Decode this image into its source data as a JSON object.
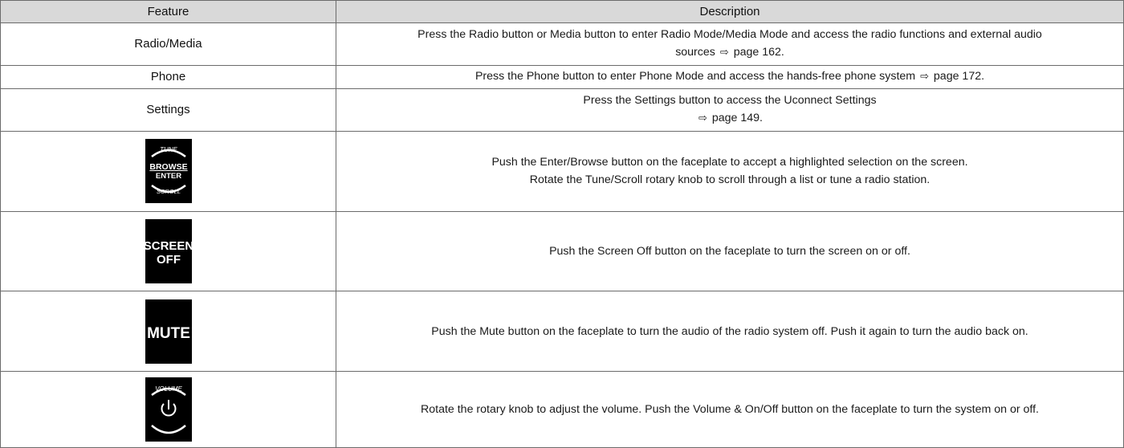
{
  "header": {
    "feature": "Feature",
    "description": "Description"
  },
  "rows": [
    {
      "feature": "Radio/Media",
      "desc_main": "Press the Radio button or Media button to enter Radio Mode/Media Mode and access the radio functions and external audio sources",
      "page_ref": "page 162."
    },
    {
      "feature": "Phone",
      "desc_main": "Press the Phone button to enter Phone Mode and access the hands-free phone system",
      "page_ref": "page 172."
    },
    {
      "feature": "Settings",
      "desc_main": "Press the Settings button to access the Uconnect Settings",
      "page_ref": "page 149."
    },
    {
      "icon": "browse-enter-knob-icon",
      "icon_text": {
        "top": "TUNE",
        "mid1": "BROWSE",
        "mid2": "ENTER",
        "bottom": "SCROLL"
      },
      "desc_line1": "Push the Enter/Browse button on the faceplate to accept a highlighted selection on the screen.",
      "desc_line2": "Rotate the Tune/Scroll rotary knob to scroll through a list or tune a radio station."
    },
    {
      "icon": "screen-off-icon",
      "icon_text": {
        "line1": "SCREEN",
        "line2": "OFF"
      },
      "desc_main": "Push the Screen Off button on the faceplate to turn the screen on or off."
    },
    {
      "icon": "mute-icon",
      "icon_text": {
        "line1": "MUTE"
      },
      "desc_main": "Push the Mute button on the faceplate to turn the audio of the radio system off. Push it again to turn the audio back on."
    },
    {
      "icon": "volume-power-knob-icon",
      "icon_text": {
        "top": "VOLUME"
      },
      "desc_main": "Rotate the rotary knob to adjust the volume. Push the Volume & On/Off button on the faceplate to turn the system on or off."
    }
  ],
  "page_ref_arrow": "⇨"
}
